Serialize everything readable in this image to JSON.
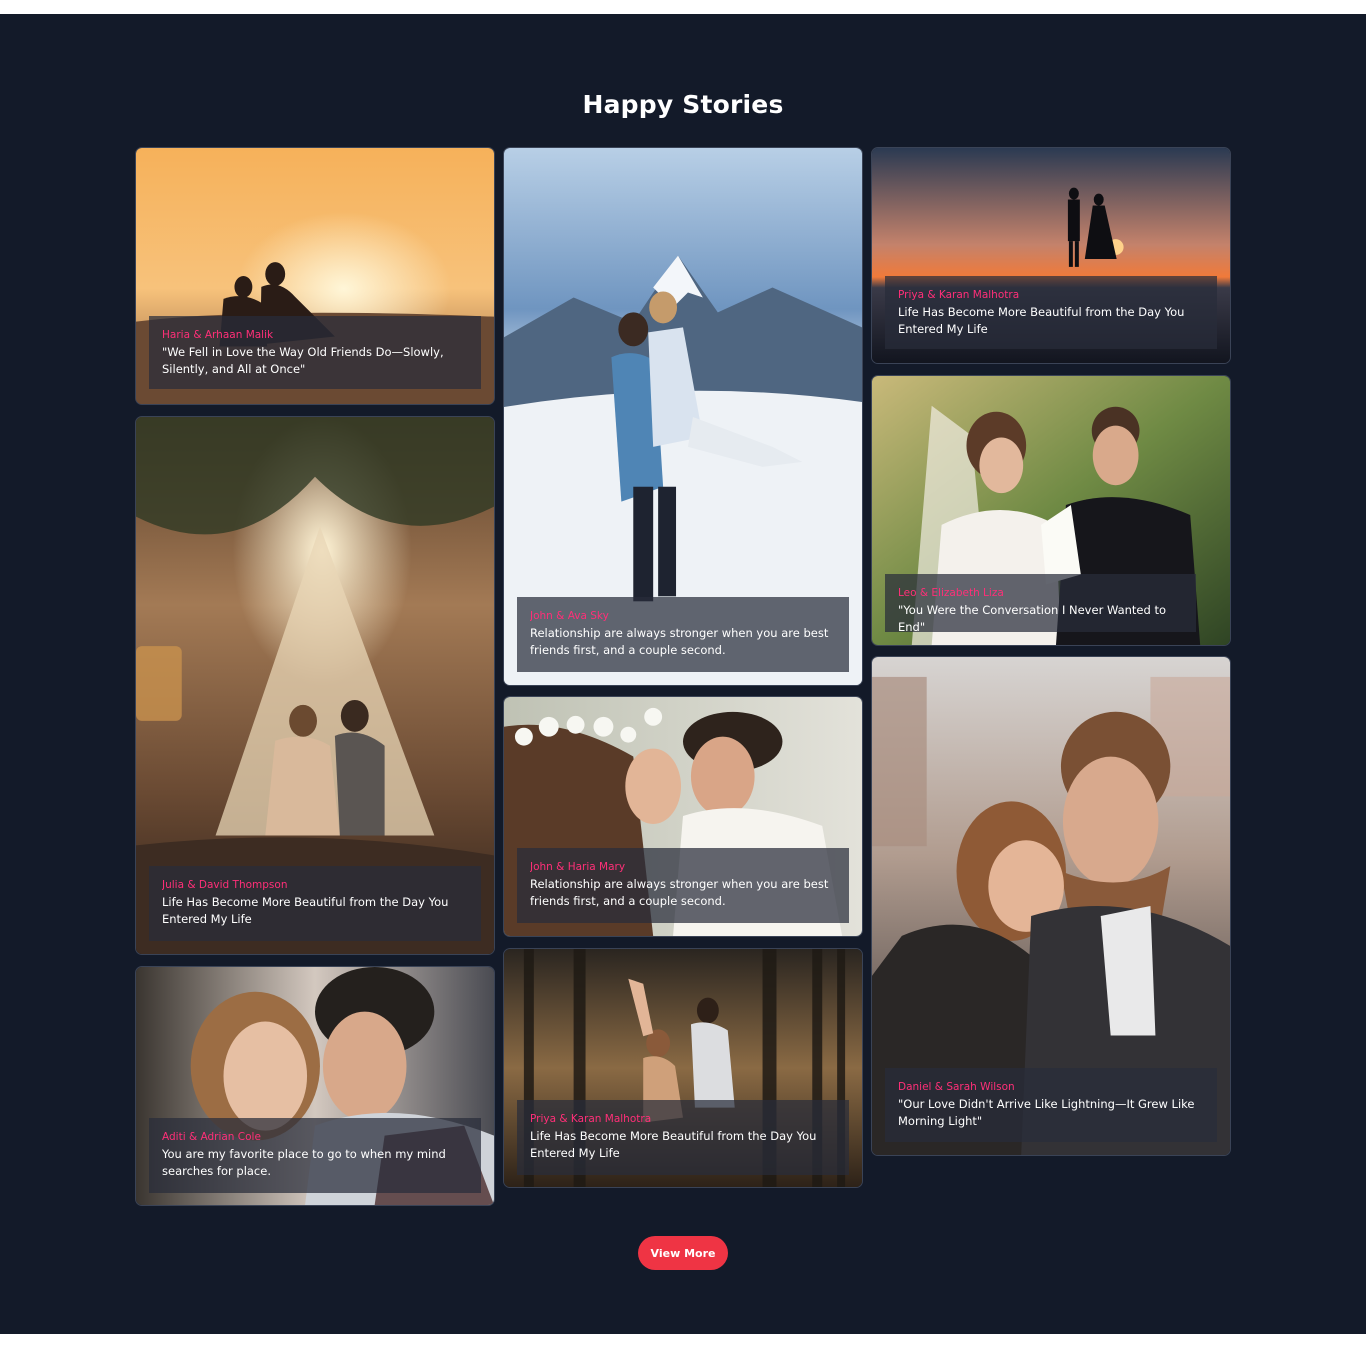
{
  "section": {
    "title": "Happy Stories",
    "view_more_label": "View More",
    "accent_color": "#ff2f78",
    "button_color": "#ef3444",
    "background_color": "#131a29"
  },
  "stories": [
    {
      "names": "Haria & Arhaan Malik",
      "quote": "\"We Fell in Love the Way Old Friends Do—Slowly, Silently, and All at Once\""
    },
    {
      "names": "John & Ava Sky",
      "quote": "Relationship are always stronger when you are best friends first, and a couple second."
    },
    {
      "names": "Priya & Karan Malhotra",
      "quote": "Life Has Become More Beautiful from the Day You Entered My Life"
    },
    {
      "names": "Julia & David Thompson",
      "quote": "Life Has Become More Beautiful from the Day You Entered My Life"
    },
    {
      "names": "Leo & Elizabeth Liza",
      "quote": "\"You Were the Conversation I Never Wanted to End\""
    },
    {
      "names": "John & Haria Mary",
      "quote": "Relationship are always stronger when you are best friends first, and a couple second."
    },
    {
      "names": "Daniel & Sarah Wilson",
      "quote": "\"Our Love Didn't Arrive Like Lightning—It Grew Like Morning Light\""
    },
    {
      "names": "Aditi & Adrian Cole",
      "quote": "You are my favorite place to go to when my mind searches for place."
    },
    {
      "names": "Priya & Karan Malhotra",
      "quote": "Life Has Become More Beautiful from the Day You Entered My Life"
    }
  ]
}
